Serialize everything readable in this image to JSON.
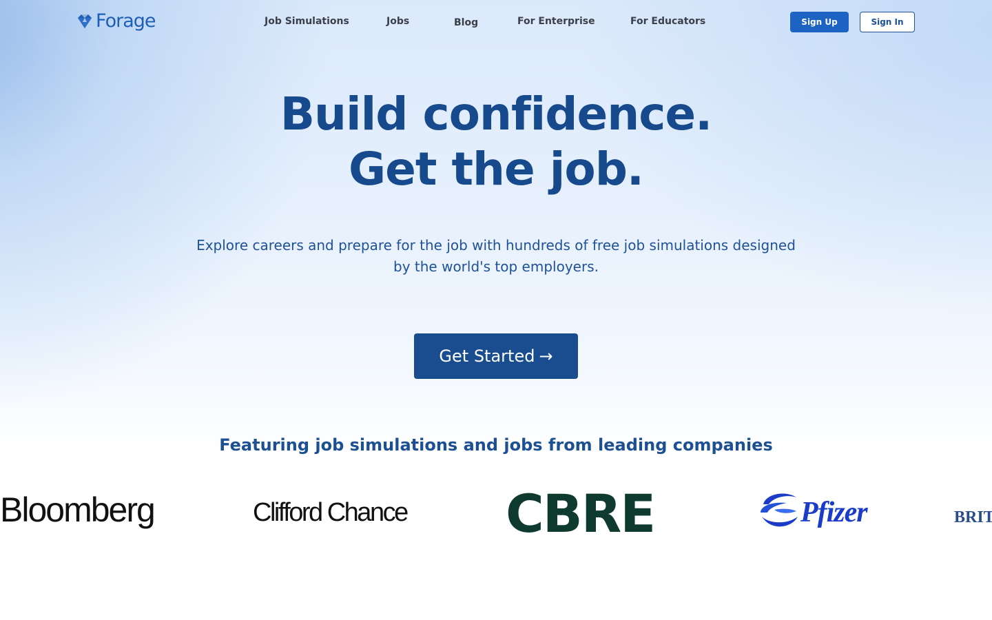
{
  "brand": {
    "name": "Forage",
    "primary_color": "#1f5fb5",
    "dark_blue": "#164a8c"
  },
  "nav": {
    "links": [
      {
        "label": "Job Simulations"
      },
      {
        "label": "Jobs"
      },
      {
        "label": "Blog"
      },
      {
        "label": "For Enterprise"
      },
      {
        "label": "For Educators"
      }
    ],
    "sign_up": "Sign Up",
    "sign_in": "Sign In"
  },
  "hero": {
    "headline_line1": "Build confidence.",
    "headline_line2": "Get the job.",
    "subtext": "Explore careers and prepare for the job with hundreds of free job simulations designed by the world's top employers.",
    "cta_label": "Get Started",
    "cta_arrow": "→"
  },
  "companies": {
    "heading": "Featuring job simulations and jobs from leading companies",
    "logos": [
      {
        "name": "Bloomberg"
      },
      {
        "name": "Clifford Chance"
      },
      {
        "name": "CBRE"
      },
      {
        "name": "Pfizer"
      },
      {
        "name": "BRIT"
      }
    ]
  }
}
